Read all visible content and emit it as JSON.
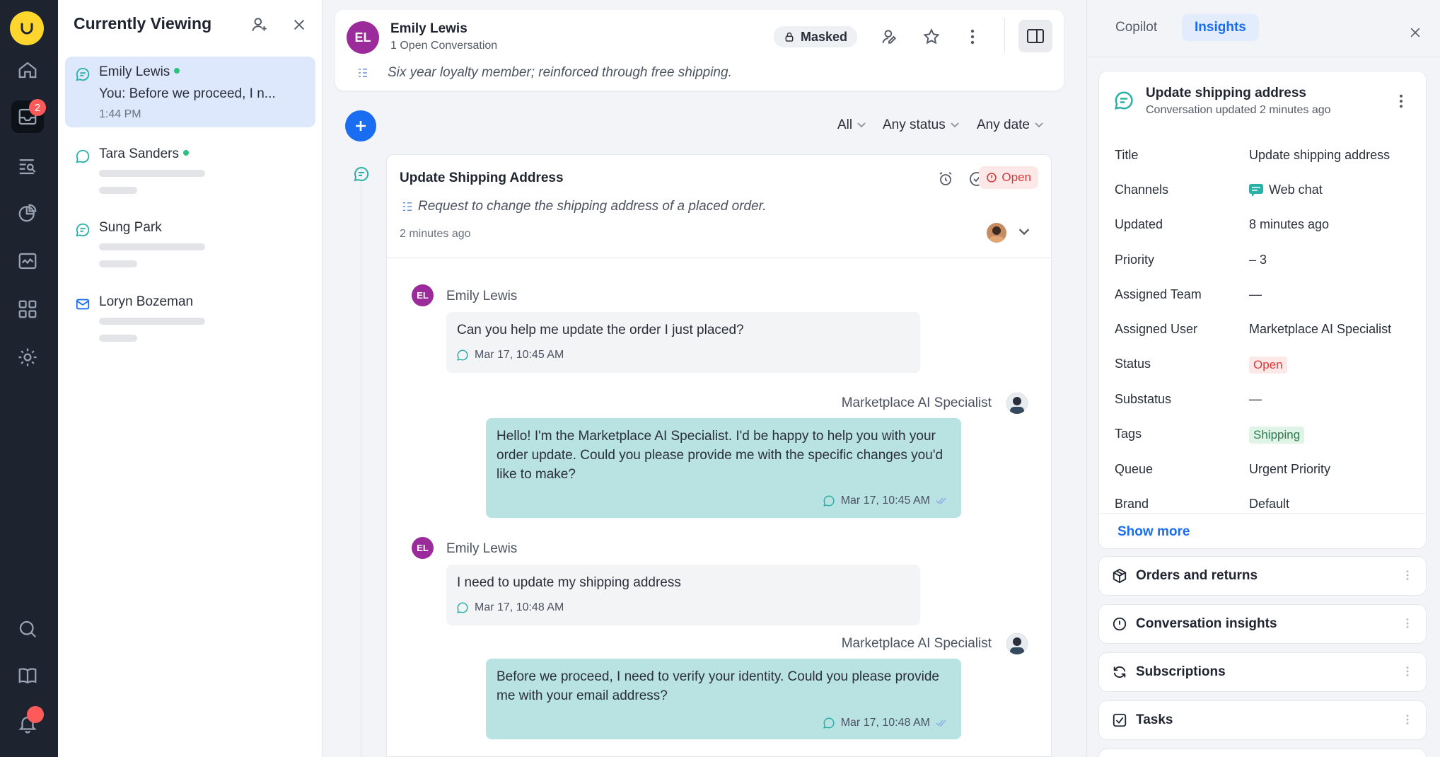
{
  "rail": {
    "notification_badge": "2"
  },
  "list_panel": {
    "title": "Currently Viewing",
    "items": [
      {
        "name": "Emily Lewis",
        "preview": "You: Before we proceed, I n...",
        "time": "1:44 PM",
        "channel": "chat-icon"
      },
      {
        "name": "Tara Sanders",
        "channel": "chat-icon"
      },
      {
        "name": "Sung Park",
        "channel": "chat-icon"
      },
      {
        "name": "Loryn Bozeman",
        "channel": "email-icon"
      }
    ]
  },
  "customer": {
    "initials": "EL",
    "name": "Emily Lewis",
    "open_count": "1 Open Conversation",
    "note": "Six year loyalty member; reinforced through free shipping.",
    "masked_label": "Masked"
  },
  "filters": {
    "type": "All",
    "status": "Any status",
    "date": "Any date"
  },
  "thread": {
    "title": "Update Shipping Address",
    "summary": "Request to change the shipping address of a placed order.",
    "time": "2 minutes ago",
    "status": "Open",
    "messages": [
      {
        "from": "Emily Lewis",
        "initials": "EL",
        "text": "Can you help me update the order I just placed?",
        "time": "Mar 17, 10:45 AM"
      },
      {
        "from": "Marketplace AI Specialist",
        "text": "Hello! I'm the Marketplace AI Specialist. I'd be happy to help you with your order update. Could you please provide me with the specific changes you'd like to make?",
        "time": "Mar 17, 10:45 AM"
      },
      {
        "from": "Emily Lewis",
        "initials": "EL",
        "text": "I need to update my shipping address",
        "time": "Mar 17, 10:48 AM"
      },
      {
        "from": "Marketplace AI Specialist",
        "text": "Before we proceed, I need to verify your identity. Could you please provide me with your email address?",
        "time": "Mar 17, 10:48 AM"
      }
    ]
  },
  "right_panel": {
    "tabs": [
      "Copilot",
      "Insights"
    ],
    "active_tab": "Insights",
    "card": {
      "title": "Update shipping address",
      "subtitle": "Conversation updated 2 minutes ago",
      "fields": [
        {
          "label": "Title",
          "value": "Update shipping address"
        },
        {
          "label": "Channels",
          "value": "Web chat"
        },
        {
          "label": "Updated",
          "value": "8 minutes ago"
        },
        {
          "label": "Priority",
          "value": "– 3"
        },
        {
          "label": "Assigned Team",
          "value": "—"
        },
        {
          "label": "Assigned User",
          "value": "Marketplace AI Specialist"
        },
        {
          "label": "Status",
          "value": "Open"
        },
        {
          "label": "Substatus",
          "value": "—"
        },
        {
          "label": "Tags",
          "value": "Shipping"
        },
        {
          "label": "Queue",
          "value": "Urgent Priority"
        },
        {
          "label": "Brand",
          "value": "Default"
        }
      ],
      "show_more": "Show more"
    },
    "sections": [
      "Orders and returns",
      "Conversation insights",
      "Subscriptions",
      "Tasks"
    ]
  },
  "colors": {
    "accent": "#1a6df0",
    "open_red": "#d83a3a",
    "ai_bubble": "#b9e3e3",
    "avatar_purple": "#9b2a9a"
  }
}
